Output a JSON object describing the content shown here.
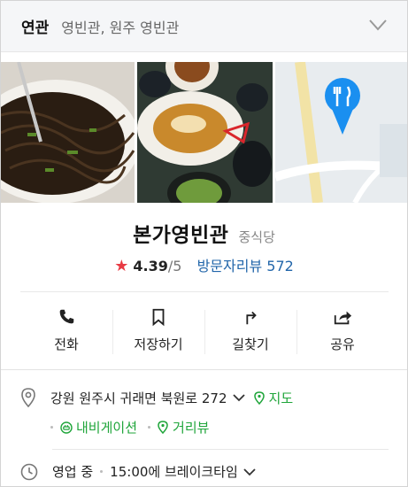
{
  "related": {
    "label": "연관",
    "value": "영빈관, 원주 영빈관"
  },
  "place": {
    "name": "본가영빈관",
    "category": "중식당",
    "rating": "4.39",
    "rating_max": "/5",
    "reviews_label": "방문자리뷰 572"
  },
  "actions": [
    {
      "label": "전화",
      "icon": "phone-icon"
    },
    {
      "label": "저장하기",
      "icon": "bookmark-icon"
    },
    {
      "label": "길찾기",
      "icon": "directions-icon"
    },
    {
      "label": "공유",
      "icon": "share-icon"
    }
  ],
  "address": {
    "text": "강원 원주시 귀래면 북원로 272",
    "map_label": "지도",
    "navi_label": "내비게이션",
    "street_label": "거리뷰"
  },
  "hours": {
    "status": "영업 중",
    "detail": "15:00에 브레이크타임"
  },
  "colors": {
    "accent_green": "#1fa53a",
    "link_blue": "#2266aa",
    "star_red": "#e83b44",
    "map_pin": "#1a8ff0"
  }
}
